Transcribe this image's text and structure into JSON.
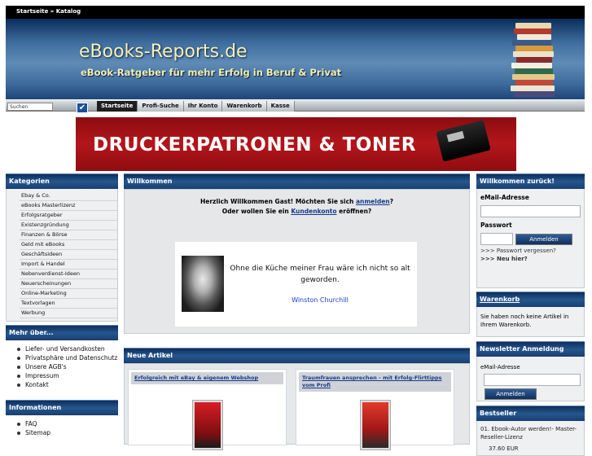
{
  "breadcrumb": "Startseite » Katalog",
  "site": {
    "title": "eBooks-Reports.de",
    "slogan": "eBook-Ratgeber für mehr Erfolg in Beruf & Privat"
  },
  "search": {
    "placeholder": "Suchen"
  },
  "nav": {
    "tabs": [
      "Startseite",
      "Profi-Suche",
      "Ihr Konto",
      "Warenkorb",
      "Kasse"
    ]
  },
  "banner": {
    "text": "DRUCKERPATRONEN & TONER"
  },
  "left": {
    "categories_title": "Kategorien",
    "categories": [
      "Ebay & Co.",
      "eBooks Masterlizenz",
      "Erfolgsratgeber",
      "Existenzgründung",
      "Finanzen & Börse",
      "Geld mit eBooks",
      "Geschäftsideen",
      "Import & Handel",
      "Nebenverdienst-Ideen",
      "Neuerscheinungen",
      "Online-Marketing",
      "Textvorlagen",
      "Werbung"
    ],
    "more_title": "Mehr über...",
    "more": [
      "Liefer- und Versandkosten",
      "Privatsphäre und Datenschutz",
      "Unsere AGB's",
      "Impressum",
      "Kontakt"
    ],
    "info_title": "Informationen",
    "info": [
      "FAQ",
      "Sitemap"
    ]
  },
  "main": {
    "welcome_title": "Willkommen",
    "welcome_line1_pre": "Herzlich Willkommen Gast! Möchten Sie sich ",
    "welcome_login_link": "anmelden",
    "welcome_line1_post": "?",
    "welcome_line2_pre": "Oder wollen Sie ein ",
    "welcome_account_link": "Kundenkonto",
    "welcome_line2_post": " eröffnen?",
    "quote": "Ohne die Küche meiner Frau wäre ich nicht so alt geworden.",
    "quote_author": "Winston Churchill",
    "new_title": "Neue Artikel",
    "articles": [
      {
        "title": "Erfolgreich mit eBay & eigenem Webshop"
      },
      {
        "title": "Traumfrauen ansprechen - mit Erfolg-Flirttipps vom Profi"
      }
    ]
  },
  "right": {
    "welcome_title": "Willkommen zurück!",
    "email_label": "eMail-Adresse",
    "password_label": "Passwort",
    "login_button": "Anmelden",
    "forgot_link": ">>> Passwort vergessen?",
    "new_here_link": ">>> Neu hier?",
    "cart_title": "Warenkorb",
    "cart_text": "Sie haben noch keine Artikel in Ihrem Warenkorb.",
    "newsletter_title": "Newsletter Anmeldung",
    "newsletter_email_label": "eMail-Adresse",
    "newsletter_button": "Anmelden",
    "bestseller_title": "Bestseller",
    "bestseller_item": "01. Ebook-Autor werden!- Master-Reseller-Lizenz",
    "bestseller_price": "37.60 EUR"
  },
  "colors": {
    "header_blue": "#26568d",
    "banner_red": "#b3161c",
    "link": "#1a3a8a"
  }
}
